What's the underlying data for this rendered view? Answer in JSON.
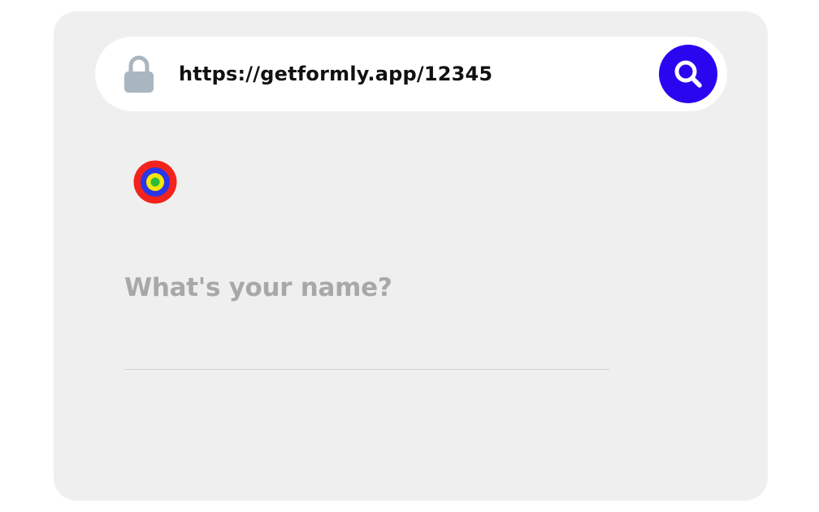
{
  "browser": {
    "url": "https://getformly.app/12345",
    "lock_icon": "lock-icon",
    "search_icon": "search-icon"
  },
  "form": {
    "logo_icon": "concentric-rings-logo-icon",
    "question": "What's your name?",
    "answer_value": ""
  },
  "colors": {
    "card_background": "#efefef",
    "url_bar_background": "#ffffff",
    "search_button": "#2a06f0",
    "lock_icon": "#a9b6c0",
    "question_text": "#a8a8a8",
    "logo_rings": [
      "#f2231c",
      "#2a36e8",
      "#f5e60a",
      "#2bbd3a"
    ]
  }
}
